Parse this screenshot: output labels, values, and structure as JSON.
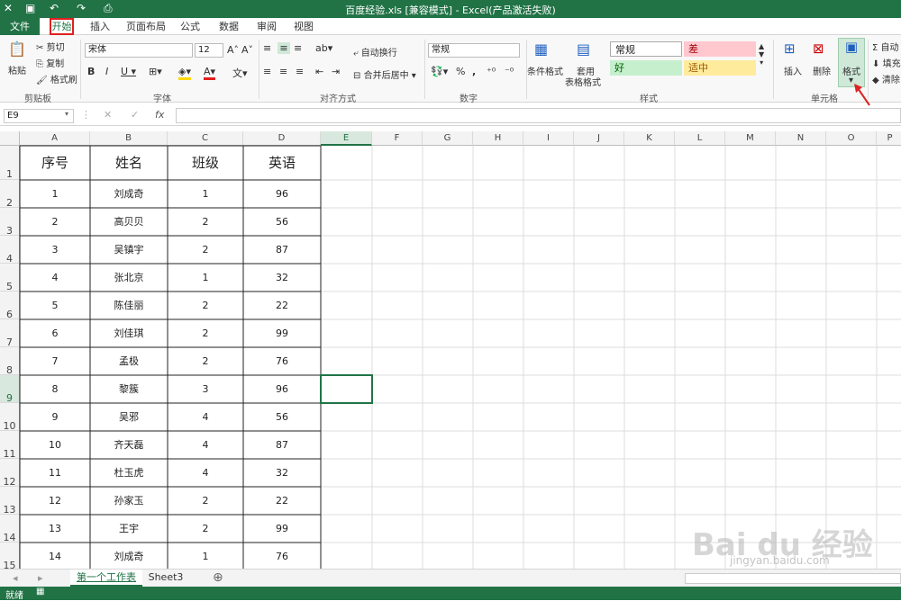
{
  "window": {
    "title": "百度经验.xls  [兼容模式]  -  Excel(产品激活失败)"
  },
  "tabs": [
    "文件",
    "开始",
    "插入",
    "页面布局",
    "公式",
    "数据",
    "审阅",
    "视图"
  ],
  "clipboard": {
    "paste": "粘贴",
    "cut": "剪切",
    "copy": "复制",
    "painter": "格式刷",
    "group": "剪贴板"
  },
  "font": {
    "name": "宋体",
    "size": "12",
    "group": "字体"
  },
  "alignment": {
    "wrap": "自动换行",
    "merge": "合并后居中",
    "group": "对齐方式"
  },
  "number": {
    "format": "常规",
    "group": "数字",
    "percent": "%",
    "comma": ","
  },
  "styles": {
    "conditional": "条件格式",
    "table_format1": "套用",
    "table_format2": "表格格式",
    "normal": "常规",
    "bad": "差",
    "good": "好",
    "neutral": "适中",
    "group": "样式"
  },
  "cells": {
    "insert": "插入",
    "delete": "删除",
    "format": "格式",
    "group": "单元格"
  },
  "editing": {
    "autosum": "自动",
    "fill": "填充",
    "clear": "清除"
  },
  "formula_bar": {
    "name_box": "E9",
    "fx": "fx"
  },
  "columns": [
    "A",
    "B",
    "C",
    "D",
    "E",
    "F",
    "G",
    "H",
    "I",
    "J",
    "K",
    "L",
    "M",
    "N",
    "O",
    "P"
  ],
  "rows": [
    "1",
    "2",
    "3",
    "4",
    "5",
    "6",
    "7",
    "8",
    "9",
    "10",
    "11",
    "12",
    "13",
    "14",
    "15"
  ],
  "table": {
    "headers": [
      "序号",
      "姓名",
      "班级",
      "英语"
    ],
    "rows": [
      [
        "1",
        "刘成奇",
        "1",
        "96"
      ],
      [
        "2",
        "高贝贝",
        "2",
        "56"
      ],
      [
        "3",
        "吴镇宇",
        "2",
        "87"
      ],
      [
        "4",
        "张北京",
        "1",
        "32"
      ],
      [
        "5",
        "陈佳丽",
        "2",
        "22"
      ],
      [
        "6",
        "刘佳琪",
        "2",
        "99"
      ],
      [
        "7",
        "孟极",
        "2",
        "76"
      ],
      [
        "8",
        "黎簇",
        "3",
        "96"
      ],
      [
        "9",
        "吴邪",
        "4",
        "56"
      ],
      [
        "10",
        "齐天磊",
        "4",
        "87"
      ],
      [
        "11",
        "杜玉虎",
        "4",
        "32"
      ],
      [
        "12",
        "孙家玉",
        "2",
        "22"
      ],
      [
        "13",
        "王宇",
        "2",
        "99"
      ],
      [
        "14",
        "刘成奇",
        "1",
        "76"
      ]
    ]
  },
  "sheets": [
    "第一个工作表",
    "Sheet3"
  ],
  "status": {
    "ready": "就绪"
  },
  "watermark": {
    "brand": "Bai du 经验",
    "url": "jingyan.baidu.com"
  },
  "colors": {
    "accent": "#217346",
    "highlight": "#e02020",
    "bad_bg": "#ffc7ce",
    "good_bg": "#c6efce",
    "neutral_bg": "#ffeb9c"
  }
}
